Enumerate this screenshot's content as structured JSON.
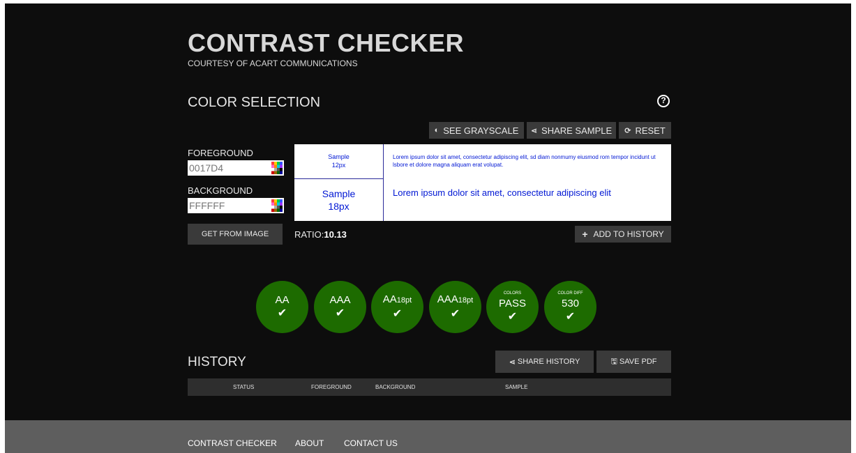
{
  "header": {
    "title": "CONTRAST CHECKER",
    "subtitle": "COURTESY OF ACART COMMUNICATIONS"
  },
  "color_selection": {
    "title": "COLOR SELECTION",
    "help_icon": "question-circle-icon",
    "toolbar": {
      "grayscale_label": "SEE GRAYSCALE",
      "share_label": "SHARE SAMPLE",
      "reset_label": "RESET"
    },
    "foreground": {
      "label": "FOREGROUND",
      "value": "0017D4"
    },
    "background": {
      "label": "BACKGROUND",
      "value": "FFFFFF"
    },
    "get_from_image_label": "GET FROM IMAGE",
    "ratio": {
      "label": "RATIO:",
      "value": "10.13"
    },
    "add_history_label": "ADD TO HISTORY",
    "sample": {
      "small_label_1": "Sample",
      "small_label_2": "12px",
      "big_label_1": "Sample",
      "big_label_2": "18px",
      "small_text": "Lorem ipsum dolor sit amet, consectetur adipiscing elit, sd diam nonmumy eiusmod rom tempor incidunt ut lsbore et dolore magna aliquam erat volupat.",
      "big_text": "Lorem ipsum dolor sit amet, consectetur adipiscing elit"
    },
    "colors": {
      "foreground": "#0017D4",
      "background": "#FFFFFF",
      "pass": "#1d6b00"
    }
  },
  "results": [
    {
      "label": "AA",
      "sub": "",
      "top": "",
      "check": "✔"
    },
    {
      "label": "AAA",
      "sub": "",
      "top": "",
      "check": "✔"
    },
    {
      "label": "AA",
      "sub": "18pt",
      "top": "",
      "check": "✔"
    },
    {
      "label": "AAA",
      "sub": "18pt",
      "top": "",
      "check": "✔"
    },
    {
      "label": "PASS",
      "sub": "",
      "top": "COLORS",
      "check": "✔"
    },
    {
      "label": "530",
      "sub": "",
      "top": "COLOR DIFF",
      "check": "✔"
    }
  ],
  "history": {
    "title": "HISTORY",
    "share_label": "SHARE HISTORY",
    "save_label": "SAVE PDF",
    "columns": [
      "STATUS",
      "FOREGROUND",
      "BACKGROUND",
      "SAMPLE"
    ]
  },
  "footer": {
    "links": [
      "CONTRAST CHECKER",
      "ABOUT",
      "CONTACT US"
    ]
  }
}
